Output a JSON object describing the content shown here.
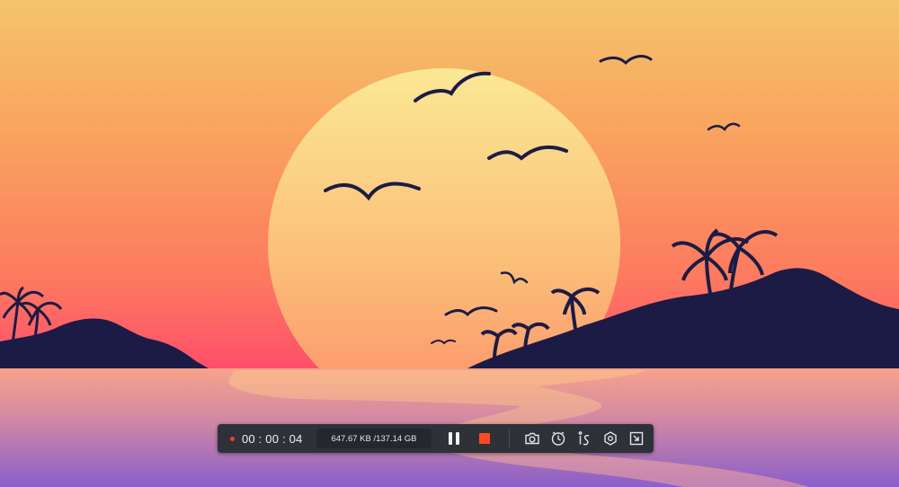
{
  "recorder": {
    "timer": "00 : 00 : 04",
    "storage": "647.67 KB /137.14 GB",
    "status": "recording"
  },
  "toolbar": {
    "pause_icon": "pause-icon",
    "stop_icon": "stop-icon",
    "tools": [
      {
        "name": "screenshot-button",
        "icon": "camera-icon"
      },
      {
        "name": "schedule-button",
        "icon": "clock-icon"
      },
      {
        "name": "auto-split-button",
        "icon": "split-icon"
      },
      {
        "name": "settings-button",
        "icon": "gear-icon"
      },
      {
        "name": "minimize-button",
        "icon": "minimize-icon"
      }
    ]
  },
  "colors": {
    "toolbar_bg": "#2f3138",
    "stop_red": "#ff4a21",
    "record_dot": "#ff3a2a",
    "sky_top": "#f2c66a",
    "sky_bottom": "#ff4f6a",
    "sun": "#fbe38e",
    "silhouette": "#1c1b45",
    "water_top": "#f7a889",
    "water_bottom": "#8b5fc8"
  }
}
